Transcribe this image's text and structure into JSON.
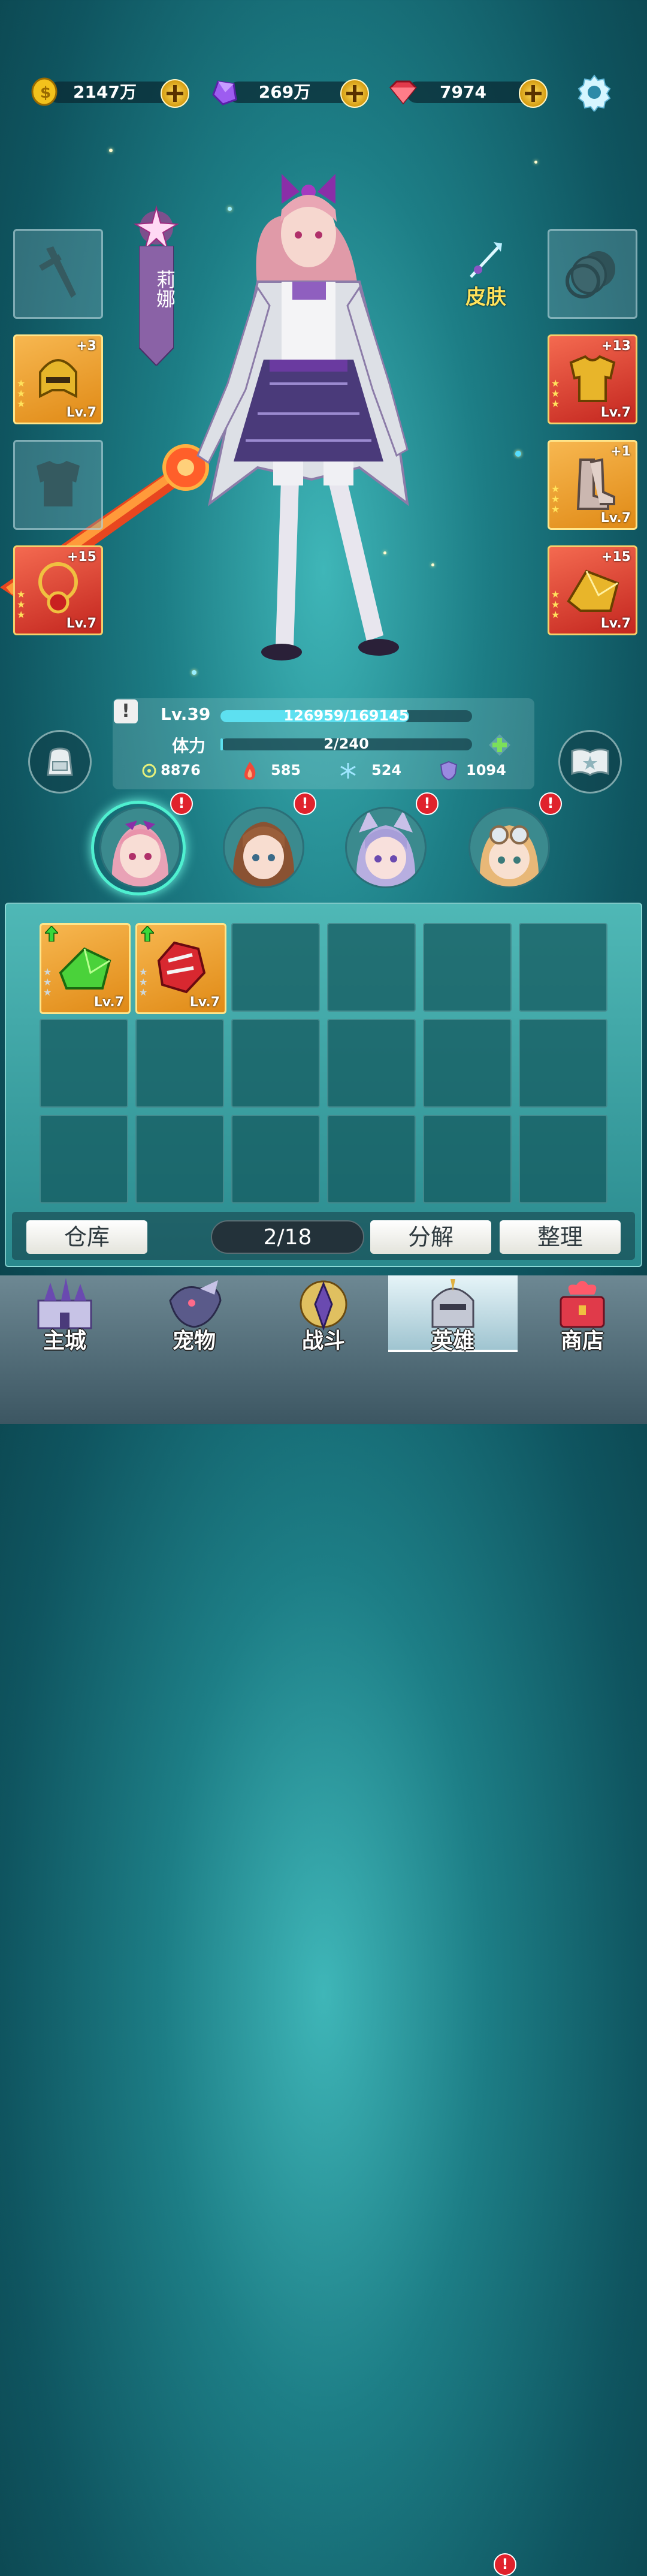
{
  "currencies": {
    "gold": "2147万",
    "crystal": "269万",
    "ruby": "7974"
  },
  "hero": {
    "name": "莉娜",
    "skin_label": "皮肤"
  },
  "equip": {
    "left_1_plus": "+3",
    "left_1_lv": "Lv.7",
    "left_2_plus": "+15",
    "left_2_lv": "Lv.7",
    "right_1_plus": "+13",
    "right_1_lv": "Lv.7",
    "right_2_plus": "+1",
    "right_2_lv": "Lv.7",
    "right_3_plus": "+15",
    "right_3_lv": "Lv.7"
  },
  "stats": {
    "level": "Lv.39",
    "exp": "126959/169145",
    "exp_fraction": 0.75,
    "stamina_label": "体力",
    "stamina": "2/240",
    "stamina_fraction": 0.008,
    "attack": "8876",
    "fire": "585",
    "ice": "524",
    "defense": "1094"
  },
  "inventory": {
    "item_1_lv": "Lv.7",
    "item_2_lv": "Lv.7",
    "count": "2/18",
    "warehouse": "仓库",
    "decompose": "分解",
    "organize": "整理"
  },
  "nav": {
    "city": "主城",
    "pet": "宠物",
    "battle": "战斗",
    "hero": "英雄",
    "shop": "商店"
  },
  "badge": "!",
  "colors": {
    "accent": "#5de0f0",
    "alert": "#e0222c"
  }
}
